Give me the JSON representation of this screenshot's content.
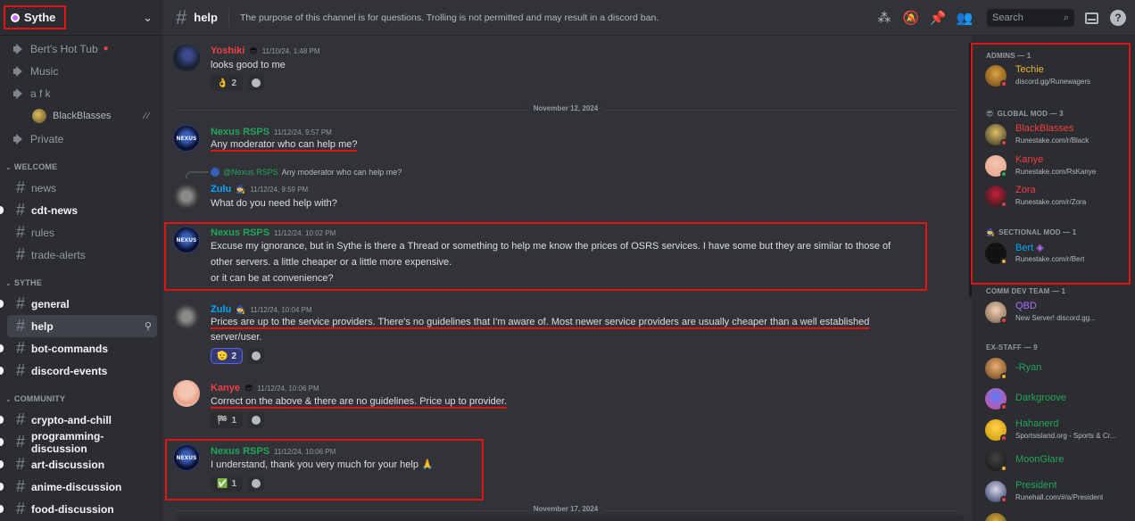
{
  "server": {
    "name": "Sythe"
  },
  "voice": [
    {
      "label": "Bert's Hot Tub"
    },
    {
      "label": "Music"
    },
    {
      "label": "a f k"
    },
    {
      "label": "BlackBlasses"
    },
    {
      "label": "Private"
    }
  ],
  "categories": {
    "welcome": "WELCOME",
    "sythe": "SYTHE",
    "community": "COMMUNITY"
  },
  "channels": {
    "news": "news",
    "cdt_news": "cdt-news",
    "rules": "rules",
    "trade_alerts": "trade-alerts",
    "general": "general",
    "help": "help",
    "bot_commands": "bot-commands",
    "discord_events": "discord-events",
    "crypto": "crypto-and-chill",
    "programming": "programming-discussion",
    "art": "art-discussion",
    "anime": "anime-discussion",
    "food": "food-discussion"
  },
  "topbar": {
    "channel": "help",
    "topic": "The purpose of this channel is for questions. Trolling is not permitted and may result in a discord ban.",
    "search_placeholder": "Search"
  },
  "messages": [
    {
      "user": "Yoshiki",
      "color": "#f23f43",
      "ts": "11/10/24, 1:48 PM",
      "text": "looks good to me",
      "react_count": "2"
    },
    {
      "divider": "November 12, 2024"
    },
    {
      "user": "Nexus RSPS",
      "color": "#23a55a",
      "ts": "11/12/24, 9:57 PM",
      "text": "Any moderator who can help me?"
    },
    {
      "reply_user": "@Nexus RSPS",
      "reply_text": "Any moderator who can help me?",
      "user": "Zulu",
      "color": "#00a8fc",
      "ts": "11/12/24, 9:59 PM",
      "text": "What do you need help with?"
    },
    {
      "user": "Nexus RSPS",
      "color": "#23a55a",
      "ts": "11/12/24, 10:02 PM",
      "line1": "Excuse my ignorance, but in Sythe is there a Thread or something to help me know the prices of OSRS services. I have some but they are similar to those of",
      "line2": "other servers. a little cheaper or a little more expensive.",
      "line3": "or it can be at convenience?"
    },
    {
      "user": "Zulu",
      "color": "#00a8fc",
      "ts": "11/12/24, 10:04 PM",
      "line1": "Prices are up to the service providers. There's no guidelines that I'm aware of. Most newer service providers are usually cheaper than a well established",
      "line2": "server/user.",
      "react_count": "2"
    },
    {
      "user": "Kanye",
      "color": "#f23f43",
      "ts": "11/12/24, 10:06 PM",
      "text": "Correct on the above & there are no guidelines. Price up to provider.",
      "react_count": "1"
    },
    {
      "user": "Nexus RSPS",
      "color": "#23a55a",
      "ts": "11/12/24, 10:06 PM",
      "text": "I understand, thank you very much for your help",
      "react_count": "1"
    },
    {
      "divider": "November 17, 2024"
    }
  ],
  "members": {
    "admins": "ADMINS — 1",
    "global_mod": "GLOBAL MOD — 3",
    "sectional_mod": "SECTIONAL MOD — 1",
    "comm_dev": "COMM DEV TEAM — 1",
    "ex_staff": "EX-STAFF — 9",
    "list": [
      {
        "name": "Techie",
        "status": "discord.gg/Runewagers"
      },
      {
        "name": "BlackBlasses",
        "status": "Runestake.com/r/Black"
      },
      {
        "name": "Kanye",
        "status": "Runestake.com/RsKanye"
      },
      {
        "name": "Zora",
        "status": "Runestake.com/r/Zora"
      },
      {
        "name": "Bert",
        "status": "Runestake.com/r/Bert"
      },
      {
        "name": "QBD",
        "status": "New Server! discord.gg..."
      },
      {
        "name": "-Ryan",
        "status": ""
      },
      {
        "name": "Darkgroove",
        "status": ""
      },
      {
        "name": "Hahanerd",
        "status": "Sportsisland.org - Sports & Cr..."
      },
      {
        "name": "MoonGlare",
        "status": ""
      },
      {
        "name": "President",
        "status": "Runehall.com/#/a/President"
      }
    ]
  },
  "colors": {
    "accent": "#5865f2",
    "highlight": "#e01414",
    "online": "#23a55a",
    "dnd": "#f23f43"
  }
}
